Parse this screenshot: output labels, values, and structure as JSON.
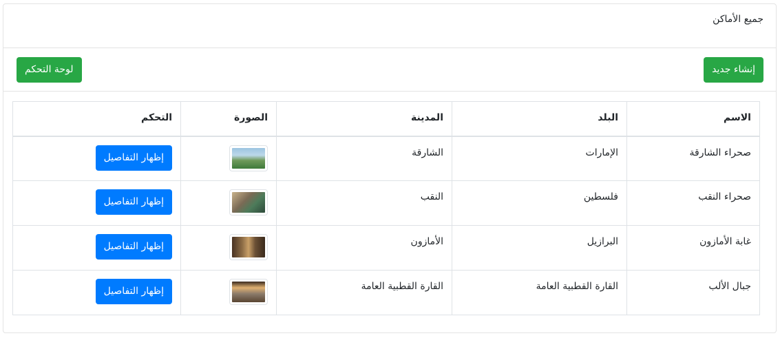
{
  "header": {
    "title": "جميع الأماكن"
  },
  "toolbar": {
    "create_label": "إنشاء جديد",
    "dashboard_label": "لوحة التحكم"
  },
  "table": {
    "headers": [
      "الاسم",
      "البلد",
      "المدينة",
      "الصورة",
      "التحكم"
    ],
    "rows": [
      {
        "name": "صحراء الشارقة",
        "country": "الإمارات",
        "city": "الشارقة",
        "action": "إظهار التفاصيل"
      },
      {
        "name": "صحراء النقب",
        "country": "فلسطين",
        "city": "النقب",
        "action": "إظهار التفاصيل"
      },
      {
        "name": "غابة الأمازون",
        "country": "البرازيل",
        "city": "الأمازون",
        "action": "إظهار التفاصيل"
      },
      {
        "name": "جبال الألب",
        "country": "القارة القطبية العامة",
        "city": "القارة القطبية العامة",
        "action": "إظهار التفاصيل"
      }
    ]
  },
  "colors": {
    "success": "#28a745",
    "primary": "#007bff",
    "border": "#dee2e6"
  }
}
